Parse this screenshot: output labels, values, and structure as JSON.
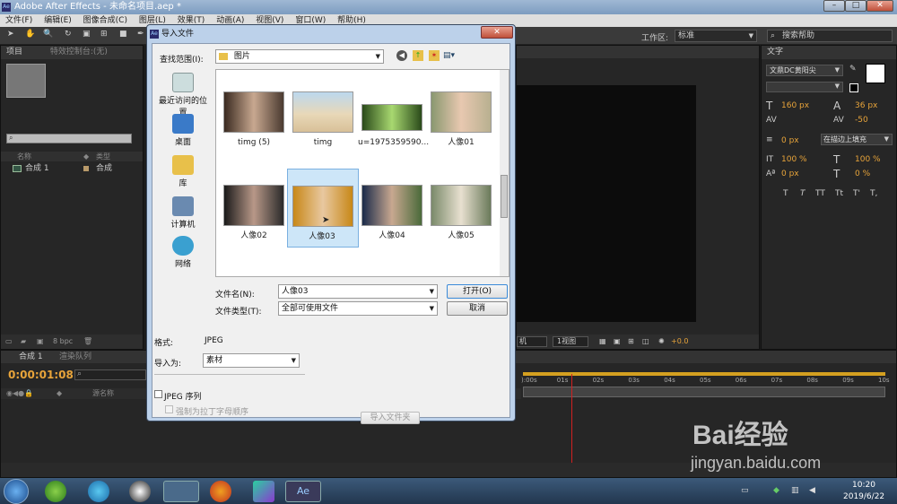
{
  "app": {
    "title": "Adobe After Effects - 未命名项目.aep *",
    "menu": [
      "文件(F)",
      "编辑(E)",
      "图像合成(C)",
      "图层(L)",
      "效果(T)",
      "动画(A)",
      "视图(V)",
      "窗口(W)",
      "帮助(H)"
    ],
    "workspace_label": "工作区:",
    "workspace_value": "标准",
    "search_help": "搜索帮助"
  },
  "project_panel": {
    "tab": "项目",
    "tab2": "特效控制台:(无)",
    "col_name": "名称",
    "col_type": "类型",
    "item_name": "合成 1",
    "item_type": "合成",
    "bpc": "8 bpc"
  },
  "text_panel": {
    "tab": "文字",
    "font": "文鼎DC黄阳尖",
    "size": "160 px",
    "leading": "36 px",
    "tracking": "-50",
    "stroke_width": "0 px",
    "stroke_mode": "在描边上填充",
    "vscale": "100 %",
    "hscale": "100 %",
    "baseline": "0 px",
    "tsume": "0 %",
    "styles": [
      "T",
      "T",
      "TT",
      "Tt",
      "T'",
      "T,"
    ]
  },
  "viewer": {
    "zoom": "1视图",
    "offset": "+0.0",
    "quality": "机"
  },
  "timeline": {
    "tab": "合成 1",
    "tab2": "渲染队列",
    "timecode": "0:00:01:08",
    "col_source": "源名称",
    "ticks": [
      "):00s",
      "01s",
      "02s",
      "03s",
      "04s",
      "05s",
      "06s",
      "07s",
      "08s",
      "09s",
      "10s"
    ],
    "playhead_fraction": 0.135
  },
  "dialog": {
    "title": "导入文件",
    "lookin_label": "查找范围(I):",
    "lookin_value": "图片",
    "places": [
      "最近访问的位置",
      "桌面",
      "库",
      "计算机",
      "网络"
    ],
    "files": [
      "timg (5)",
      "timg",
      "u=1975359590...",
      "人像01",
      "人像02",
      "人像03",
      "人像04",
      "人像05"
    ],
    "selected_file": "人像03",
    "filename_label": "文件名(N):",
    "filename_value": "人像03",
    "filetype_label": "文件类型(T):",
    "filetype_value": "全部可使用文件",
    "open_button": "打开(O)",
    "cancel_button": "取消",
    "format_label": "格式:",
    "format_value": "JPEG",
    "importas_label": "导入为:",
    "importas_value": "素材",
    "sequence_label": "JPEG 序列",
    "alpha_label": "强制为拉丁字母顺序",
    "import_folder_button": "导入文件夹"
  },
  "taskbar": {
    "time": "10:20",
    "date": "2019/6/22"
  },
  "watermark": {
    "brand": "Bai经验",
    "url": "jingyan.baidu.com"
  }
}
